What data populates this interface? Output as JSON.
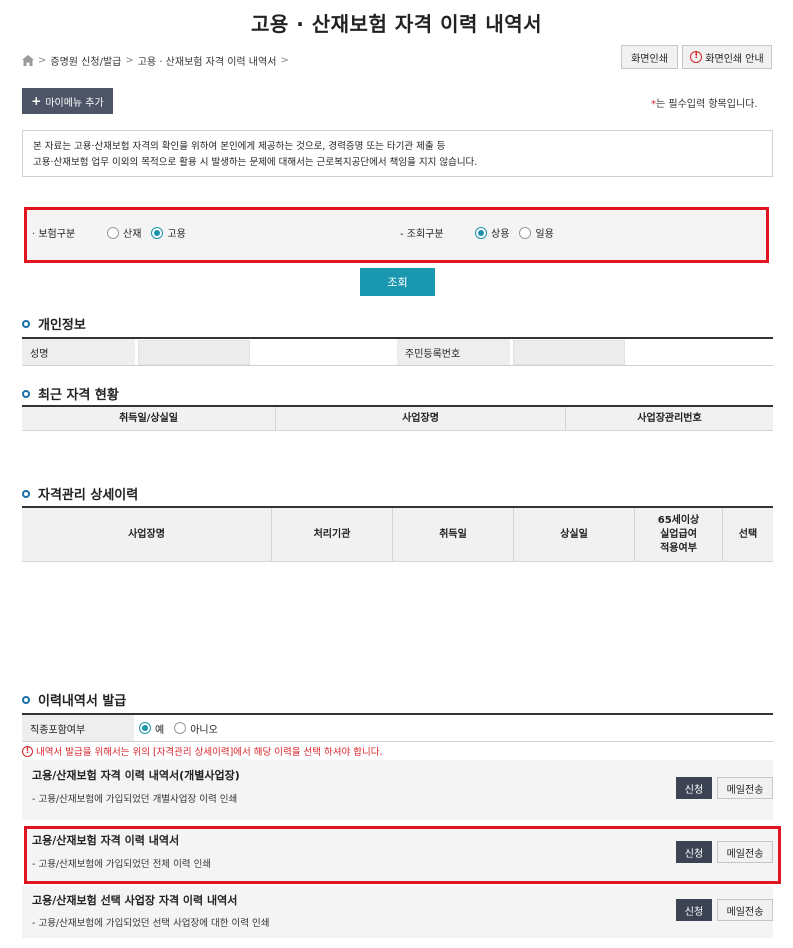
{
  "page": {
    "title": "고용 · 산재보험 자격 이력 내역서"
  },
  "breadcrumb": {
    "items": [
      "증명원 신청/발급",
      "고용 · 산재보험 자격 이력 내역서"
    ],
    "separator": ">"
  },
  "toolbar": {
    "print_label": "화면인쇄",
    "print_guide_label": "화면인쇄 안내",
    "mymenu_label": "마이메뉴 추가",
    "mymenu_plus": "+",
    "required_star": "*",
    "required_text": "는 필수입력 항목입니다.",
    "alert_glyph": "!"
  },
  "notice": {
    "line1": "본 자료는 고용·산재보험 자격의 확인을 위하여 본인에게 제공하는 것으로, 경력증명 또는 타기관 제출 등",
    "line2": "고용·산재보험 업무 이외의 목적으로 활용 시 발생하는 문제에 대해서는 근로복지공단에서 책임을 지지 않습니다."
  },
  "filter": {
    "insurance_label": "· 보험구분",
    "insurance_options": [
      "산재",
      "고용"
    ],
    "insurance_selected": "고용",
    "query_label": "- 조회구분",
    "query_options": [
      "상용",
      "일용"
    ],
    "query_selected": "상용",
    "search_button": "조회"
  },
  "personal": {
    "section_title": "개인정보",
    "name_label": "성명",
    "rrn_label": "주민등록번호"
  },
  "recent": {
    "section_title": "최근 자격 현황",
    "columns": [
      "취득일/상실일",
      "사업장명",
      "사업장관리번호"
    ]
  },
  "detail": {
    "section_title": "자격관리 상세이력",
    "columns": [
      "사업장명",
      "처리기관",
      "취득일",
      "상실일",
      "65세이상 실업급여 적용여부",
      "선택"
    ],
    "col5_lines": [
      "65세이상",
      "실업급여",
      "적용여부"
    ]
  },
  "issue": {
    "section_title": "이력내역서 발급",
    "job_label": "직종포함여부",
    "job_options": [
      "예",
      "아니오"
    ],
    "job_selected": "예",
    "warning": "내역서 발급을 위해서는 위의 [자격관리 상세이력]에서 해당 이력을 선택 하셔야 합니다.",
    "docs": [
      {
        "title": "고용/산재보험 자격 이력 내역서(개별사업장)",
        "desc": "- 고용/산재보험에 가입되었던 개별사업장 이력 인쇄",
        "apply": "신청",
        "mail": "메일전송"
      },
      {
        "title": "고용/산재보험 자격 이력 내역서",
        "desc": "- 고용/산재보험에 가입되었던 전체 이력 인쇄",
        "apply": "신청",
        "mail": "메일전송"
      },
      {
        "title": "고용/산재보험 선택 사업장 자격 이력 내역서",
        "desc": "- 고용/산재보험에 가입되었던 선택 사업장에 대한 이력 인쇄",
        "apply": "신청",
        "mail": "메일전송"
      }
    ]
  },
  "colors": {
    "highlight": "#e1151f",
    "accent": "#1a98b0",
    "dark_button": "#3c4454"
  }
}
